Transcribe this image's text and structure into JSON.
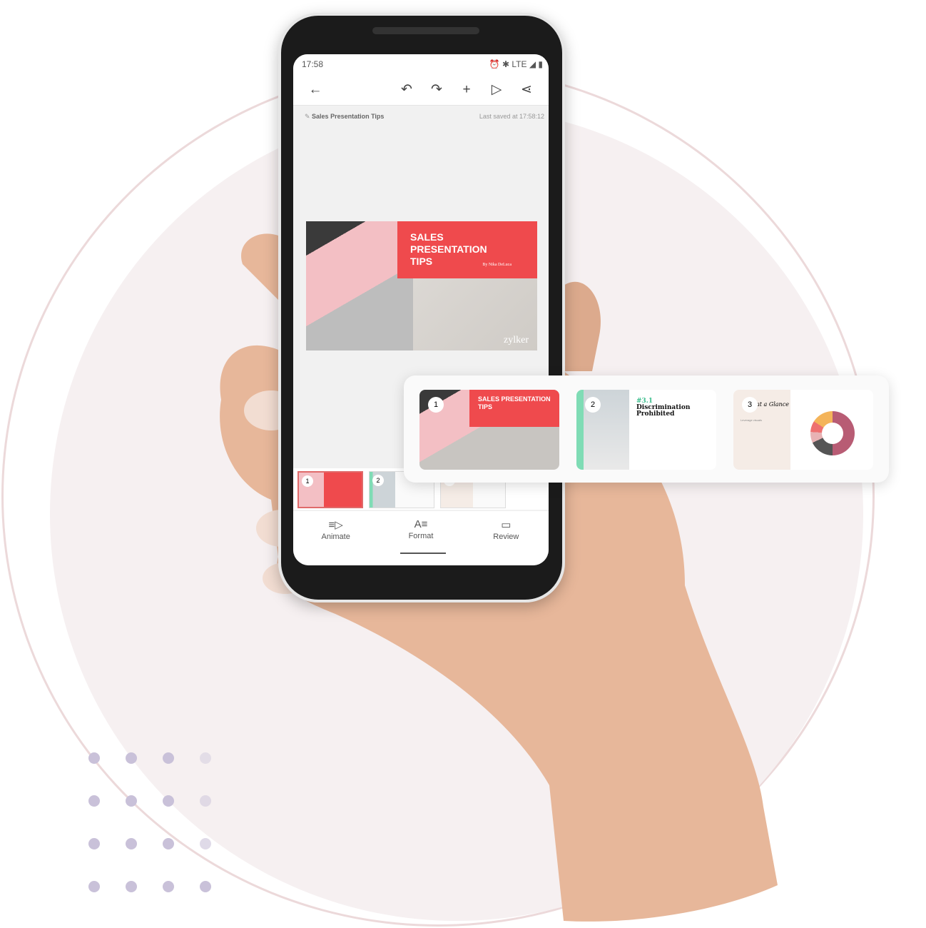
{
  "status_bar": {
    "time": "17:58",
    "icons": "⏰ ✱ LTE ◢ ▮"
  },
  "toolbar": {
    "back": "←",
    "undo": "↶",
    "redo": "↷",
    "add": "+",
    "play": "▷",
    "share": "⋖"
  },
  "document": {
    "title": "Sales Presentation Tips",
    "last_saved": "Last saved at 17:58:12"
  },
  "slide": {
    "title_lines": [
      "SALES",
      "PRESENTATION",
      "TIPS"
    ],
    "byline": "By Nika DeLuca",
    "logo": "zylker"
  },
  "thumbnails": [
    {
      "number": "1"
    },
    {
      "number": "2"
    },
    {
      "number": "3"
    }
  ],
  "bottom_tabs": [
    {
      "label": "Animate",
      "icon": "≡▷"
    },
    {
      "label": "Format",
      "icon": "A≡"
    },
    {
      "label": "Review",
      "icon": "▭"
    }
  ],
  "active_tab": "Format",
  "panel": {
    "cards": [
      {
        "number": "1",
        "title": "SALES PRESENTATION TIPS"
      },
      {
        "number": "2",
        "heading": "#3.1",
        "title": "Discrimination Prohibited"
      },
      {
        "number": "3",
        "title": "at a Glance",
        "subtitle": "Leverage visuals"
      }
    ]
  },
  "colors": {
    "accent_red": "#ef4a4d",
    "teal_accent": "#7fdcb5",
    "background_disc": "#f6f0f1"
  }
}
